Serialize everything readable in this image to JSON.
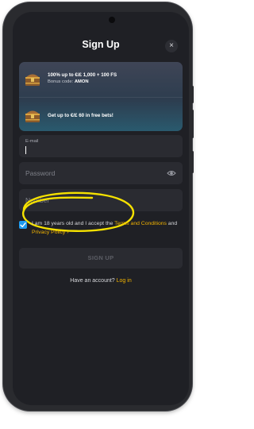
{
  "modal": {
    "title": "Sign Up",
    "close_icon": "close-icon",
    "close_glyph": "×"
  },
  "promos": [
    {
      "main": "100% up to €/£ 1,000 + 100 FS",
      "sub_label": "Bonus code:",
      "sub_code": "AMON",
      "icon": "treasure-chest-icon"
    },
    {
      "main": "Get up to €/£ 60 in free bets!",
      "icon": "treasure-chest-icon"
    }
  ],
  "form": {
    "email_label": "E-mail",
    "password_placeholder": "Password",
    "number_placeholder": "Number",
    "password_toggle_icon": "eye-icon",
    "terms_prefix": "I am 18 years old and I accept the ",
    "terms_link": "Terms and Conditions",
    "terms_and": " and ",
    "privacy_link": "Privacy Policy",
    "privacy_suffix": " ›",
    "terms_checked": true,
    "submit_label": "SIGN UP"
  },
  "footer": {
    "have_account_text": "Have an account? ",
    "login_link": "Log in"
  },
  "colors": {
    "accent": "#f2b300",
    "checkbox": "#1d9bf0",
    "background": "#1f2025",
    "annotation": "#f5e100"
  }
}
